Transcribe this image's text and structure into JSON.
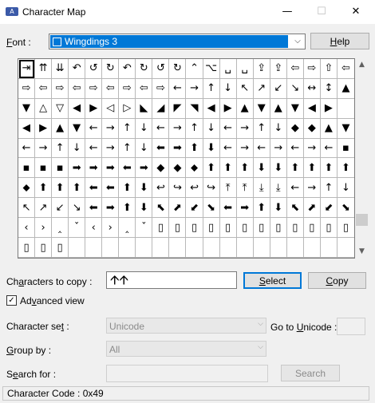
{
  "window": {
    "title": "Character Map",
    "minimize_glyph": "—",
    "maximize_glyph": "☐",
    "close_glyph": "✕",
    "app_icon_text": "A"
  },
  "font_row": {
    "label_u": "F",
    "label_rest": "ont :",
    "selected_font": "Wingdings 3",
    "dropdown_arrow": "⌵"
  },
  "help_button": {
    "u": "H",
    "rest": "elp"
  },
  "grid": {
    "selected_index": 0,
    "cells": [
      "⇥",
      "⇈",
      "⇊",
      "↶",
      "↺",
      "↻",
      "↶",
      "↻",
      "↺",
      "↻",
      "⌃",
      "⌥",
      "␣",
      "␣",
      "⇪",
      "⇪",
      "⇦",
      "⇨",
      "⇧",
      "⇦",
      "⇨",
      "⇦",
      "⇨",
      "⇦",
      "⇨",
      "⇦",
      "⇨",
      "⇦",
      "⇨",
      "←",
      "→",
      "↑",
      "↓",
      "↖",
      "↗",
      "↙",
      "↘",
      "↔",
      "↕",
      "▲",
      "▼",
      "△",
      "▽",
      "◀",
      "▶",
      "◁",
      "▷",
      "◣",
      "◢",
      "◤",
      "◥",
      "◀",
      "▶",
      "▲",
      "▼",
      "▲",
      "▼",
      "◀",
      "▶",
      "",
      "◀",
      "▶",
      "▲",
      "▼",
      "←",
      "→",
      "↑",
      "↓",
      "←",
      "→",
      "↑",
      "↓",
      "←",
      "→",
      "↑",
      "↓",
      "◆",
      "◆",
      "▲",
      "▼",
      "←",
      "→",
      "↑",
      "↓",
      "←",
      "→",
      "↑",
      "↓",
      "⬅",
      "➡",
      "⬆",
      "⬇",
      "←",
      "→",
      "←",
      "→",
      "←",
      "→",
      "←",
      "▪",
      "▪",
      "▪",
      "▪",
      "➡",
      "➡",
      "➡",
      "⬅",
      "➡",
      "◆",
      "◆",
      "⬥",
      "⬆",
      "⬆",
      "⬆",
      "⬇",
      "⬇",
      "⬆",
      "⬆",
      "⬆",
      "⬆",
      "⬥",
      "⬆",
      "⬆",
      "⬆",
      "⬅",
      "⬅",
      "⬆",
      "⬇",
      "↩",
      "↪",
      "↩",
      "↪",
      "⤒",
      "⤒",
      "⤓",
      "⤓",
      "←",
      "→",
      "↑",
      "↓",
      "↖",
      "↗",
      "↙",
      "↘",
      "⬅",
      "➡",
      "⬆",
      "⬇",
      "⬉",
      "⬈",
      "⬋",
      "⬊",
      "⬅",
      "➡",
      "⬆",
      "⬇",
      "⬉",
      "⬈",
      "⬋",
      "⬊",
      "‹",
      "›",
      "‸",
      "ˇ",
      "‹",
      "›",
      "‸",
      "ˇ",
      "▯",
      "▯",
      "▯",
      "▯",
      "▯",
      "▯",
      "▯",
      "▯",
      "▯",
      "▯",
      "▯",
      "▯",
      "▯",
      "▯",
      "▯",
      "",
      "",
      "",
      "",
      "",
      "",
      "",
      "",
      "",
      "",
      "",
      "",
      "",
      "",
      "",
      "",
      ""
    ]
  },
  "scrollbar": {
    "up": "▲",
    "down": "▼",
    "position": 0.88
  },
  "copy_row": {
    "label_before": "Ch",
    "label_u": "a",
    "label_after": "racters to copy :",
    "value": "🡩🡩",
    "select_u": "S",
    "select_rest": "elect",
    "copy_u": "C",
    "copy_rest": "opy"
  },
  "advanced": {
    "checked": true,
    "check_glyph": "✓",
    "label_pre": "Ad",
    "label_u": "v",
    "label_post": "anced view"
  },
  "charset": {
    "label_pre": "Character se",
    "label_u": "t",
    "label_post": " :",
    "value": "Unicode",
    "arrow": "⌵"
  },
  "goto_unicode": {
    "label_pre": "Go to ",
    "label_u": "U",
    "label_post": "nicode :"
  },
  "groupby": {
    "label_pre": "",
    "label_u": "G",
    "label_post": "roup by :",
    "value": "All",
    "arrow": "⌵"
  },
  "searchfor": {
    "label_pre": "S",
    "label_u": "e",
    "label_post": "arch for :",
    "button": "Search"
  },
  "status": {
    "text": "Character Code : 0x49"
  }
}
